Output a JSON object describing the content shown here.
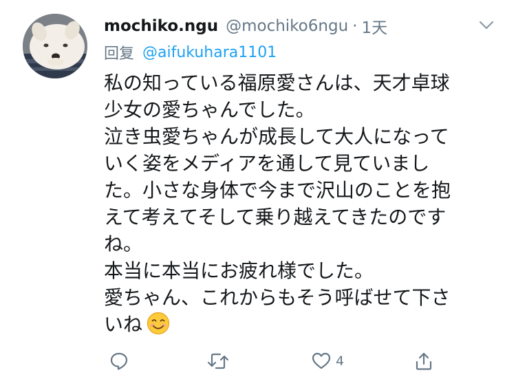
{
  "tweet": {
    "display_name": "mochiko.ngu",
    "handle": "@mochiko6ngu",
    "separator": "·",
    "time": "1天",
    "reply_label": "回复",
    "reply_to": "@aifukuhara1101",
    "lines": [
      "私の知っている福原愛さんは、天才卓球",
      "少女の愛ちゃんでした。",
      "泣き虫愛ちゃんが成長して大人になって",
      "いく姿をメディアを通して見ていまし",
      "た。小さな身体で今まで沢山のことを抱",
      "えて考えてそして乗り越えてきたのです",
      "ね。",
      "本当に本当にお疲れ様でした。",
      "愛ちゃん、これからもそう呼ばせて下さ",
      "いね"
    ],
    "emoji": "smiling-face-emoji",
    "like_count": "4"
  },
  "icons": {
    "reply": "reply-icon",
    "retweet": "retweet-icon",
    "like": "heart-icon",
    "share": "share-icon",
    "menu": "chevron-down-icon"
  },
  "colors": {
    "text": "#14171a",
    "secondary": "#657786",
    "link": "#1da1f2"
  }
}
